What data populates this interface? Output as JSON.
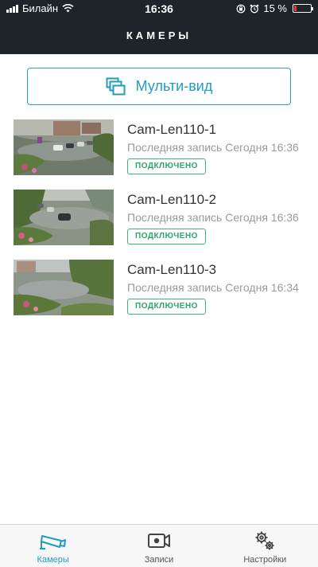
{
  "status_bar": {
    "carrier": "Билайн",
    "time": "16:36",
    "battery": "15 %",
    "battery_level": 0.15
  },
  "header": {
    "title": "КАМЕРЫ"
  },
  "multi_view": {
    "label": "Мульти-вид",
    "icon": "multi-view-icon"
  },
  "cameras": [
    {
      "name": "Cam-Len110-1",
      "last_record": "Последняя запись Сегодня 16:36",
      "status": "ПОДКЛЮЧЕНО"
    },
    {
      "name": "Cam-Len110-2",
      "last_record": "Последняя запись Сегодня 16:36",
      "status": "ПОДКЛЮЧЕНО"
    },
    {
      "name": "Cam-Len110-3",
      "last_record": "Последняя запись Сегодня 16:34",
      "status": "ПОДКЛЮЧЕНО"
    }
  ],
  "tabbar": {
    "tabs": [
      {
        "label": "Камеры",
        "icon": "camera-cctv-icon",
        "active": true
      },
      {
        "label": "Записи",
        "icon": "video-record-icon",
        "active": false
      },
      {
        "label": "Настройки",
        "icon": "gears-icon",
        "active": false
      }
    ]
  },
  "colors": {
    "accent": "#1e9cc4",
    "status_green": "#3cb878",
    "header_bg": "#1e2429",
    "battery_low": "#e8352d"
  }
}
